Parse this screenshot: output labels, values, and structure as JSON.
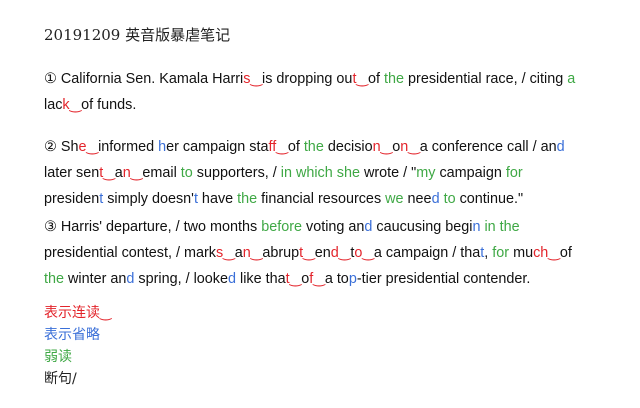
{
  "title": "20191209 英音版暴虐笔记",
  "colors": {
    "liaison": "#e3242b",
    "elision": "#3a6fd8",
    "weak": "#3fa845",
    "text": "#111111"
  },
  "paragraphs": [
    {
      "lines": [
        [
          {
            "c": "k",
            "t": "① California Sen. Kamala Harri"
          },
          {
            "c": "r",
            "t": "s‿"
          },
          {
            "c": "k",
            "t": "is dropping ou"
          },
          {
            "c": "r",
            "t": "t‿"
          },
          {
            "c": "k",
            "t": "of "
          },
          {
            "c": "g",
            "t": "the"
          },
          {
            "c": "k",
            "t": " presidential race, / citing "
          },
          {
            "c": "g",
            "t": "a"
          }
        ],
        [
          {
            "c": "k",
            "t": "lac"
          },
          {
            "c": "r",
            "t": "k‿"
          },
          {
            "c": "k",
            "t": "of funds."
          }
        ]
      ]
    },
    {
      "lines": [
        [
          {
            "c": "k",
            "t": "② Sh"
          },
          {
            "c": "r",
            "t": "e‿"
          },
          {
            "c": "k",
            "t": "informed "
          },
          {
            "c": "b",
            "t": "h"
          },
          {
            "c": "k",
            "t": "er campaign sta"
          },
          {
            "c": "r",
            "t": "ff‿"
          },
          {
            "c": "k",
            "t": "of "
          },
          {
            "c": "g",
            "t": "the"
          },
          {
            "c": "k",
            "t": " decisio"
          },
          {
            "c": "r",
            "t": "n‿"
          },
          {
            "c": "k",
            "t": "o"
          },
          {
            "c": "r",
            "t": "n‿"
          },
          {
            "c": "k",
            "t": "a conference call / an"
          },
          {
            "c": "b",
            "t": "d"
          }
        ],
        [
          {
            "c": "k",
            "t": "later sen"
          },
          {
            "c": "r",
            "t": "t‿"
          },
          {
            "c": "k",
            "t": "a"
          },
          {
            "c": "r",
            "t": "n‿"
          },
          {
            "c": "k",
            "t": "email "
          },
          {
            "c": "g",
            "t": "to"
          },
          {
            "c": "k",
            "t": " supporters, / "
          },
          {
            "c": "g",
            "t": "in which she"
          },
          {
            "c": "k",
            "t": " wrote / \""
          },
          {
            "c": "g",
            "t": "my"
          },
          {
            "c": "k",
            "t": " campaign "
          },
          {
            "c": "g",
            "t": "for"
          }
        ],
        [
          {
            "c": "k",
            "t": "presiden"
          },
          {
            "c": "b",
            "t": "t"
          },
          {
            "c": "k",
            "t": " simply doesn'"
          },
          {
            "c": "b",
            "t": "t"
          },
          {
            "c": "k",
            "t": " have "
          },
          {
            "c": "g",
            "t": "the"
          },
          {
            "c": "k",
            "t": " financial resources "
          },
          {
            "c": "g",
            "t": "we"
          },
          {
            "c": "k",
            "t": " nee"
          },
          {
            "c": "b",
            "t": "d"
          },
          {
            "c": "k",
            "t": " "
          },
          {
            "c": "g",
            "t": "to"
          },
          {
            "c": "k",
            "t": " continue.\""
          }
        ]
      ]
    },
    {
      "lines": [
        [
          {
            "c": "k",
            "t": "③ Harris' departure, / two months "
          },
          {
            "c": "g",
            "t": "before"
          },
          {
            "c": "k",
            "t": " voting an"
          },
          {
            "c": "b",
            "t": "d"
          },
          {
            "c": "k",
            "t": " caucusing begi"
          },
          {
            "c": "b",
            "t": "n"
          },
          {
            "c": "k",
            "t": " "
          },
          {
            "c": "g",
            "t": "in"
          },
          {
            "c": "k",
            "t": " "
          },
          {
            "c": "g",
            "t": "the"
          }
        ],
        [
          {
            "c": "k",
            "t": "presidential contest, / mark"
          },
          {
            "c": "r",
            "t": "s‿"
          },
          {
            "c": "k",
            "t": "a"
          },
          {
            "c": "r",
            "t": "n‿"
          },
          {
            "c": "k",
            "t": "abrup"
          },
          {
            "c": "r",
            "t": "t‿"
          },
          {
            "c": "k",
            "t": "en"
          },
          {
            "c": "r",
            "t": "d‿"
          },
          {
            "c": "k",
            "t": "t"
          },
          {
            "c": "r",
            "t": "o‿"
          },
          {
            "c": "k",
            "t": "a campaign / tha"
          },
          {
            "c": "b",
            "t": "t"
          },
          {
            "c": "k",
            "t": ", "
          },
          {
            "c": "g",
            "t": "for"
          },
          {
            "c": "k",
            "t": " mu"
          },
          {
            "c": "r",
            "t": "ch‿"
          },
          {
            "c": "k",
            "t": "of"
          }
        ],
        [
          {
            "c": "g",
            "t": "the"
          },
          {
            "c": "k",
            "t": " winter an"
          },
          {
            "c": "b",
            "t": "d"
          },
          {
            "c": "k",
            "t": " spring, / looke"
          },
          {
            "c": "b",
            "t": "d"
          },
          {
            "c": "k",
            "t": " like tha"
          },
          {
            "c": "r",
            "t": "t‿"
          },
          {
            "c": "k",
            "t": "o"
          },
          {
            "c": "r",
            "t": "f‿"
          },
          {
            "c": "k",
            "t": "a to"
          },
          {
            "c": "b",
            "t": "p"
          },
          {
            "c": "k",
            "t": "-tier presidential contender."
          }
        ]
      ]
    }
  ],
  "legend": {
    "liaison": "表示连读‿",
    "elision": "表示省略",
    "weak": "弱读",
    "break": "断句/"
  }
}
